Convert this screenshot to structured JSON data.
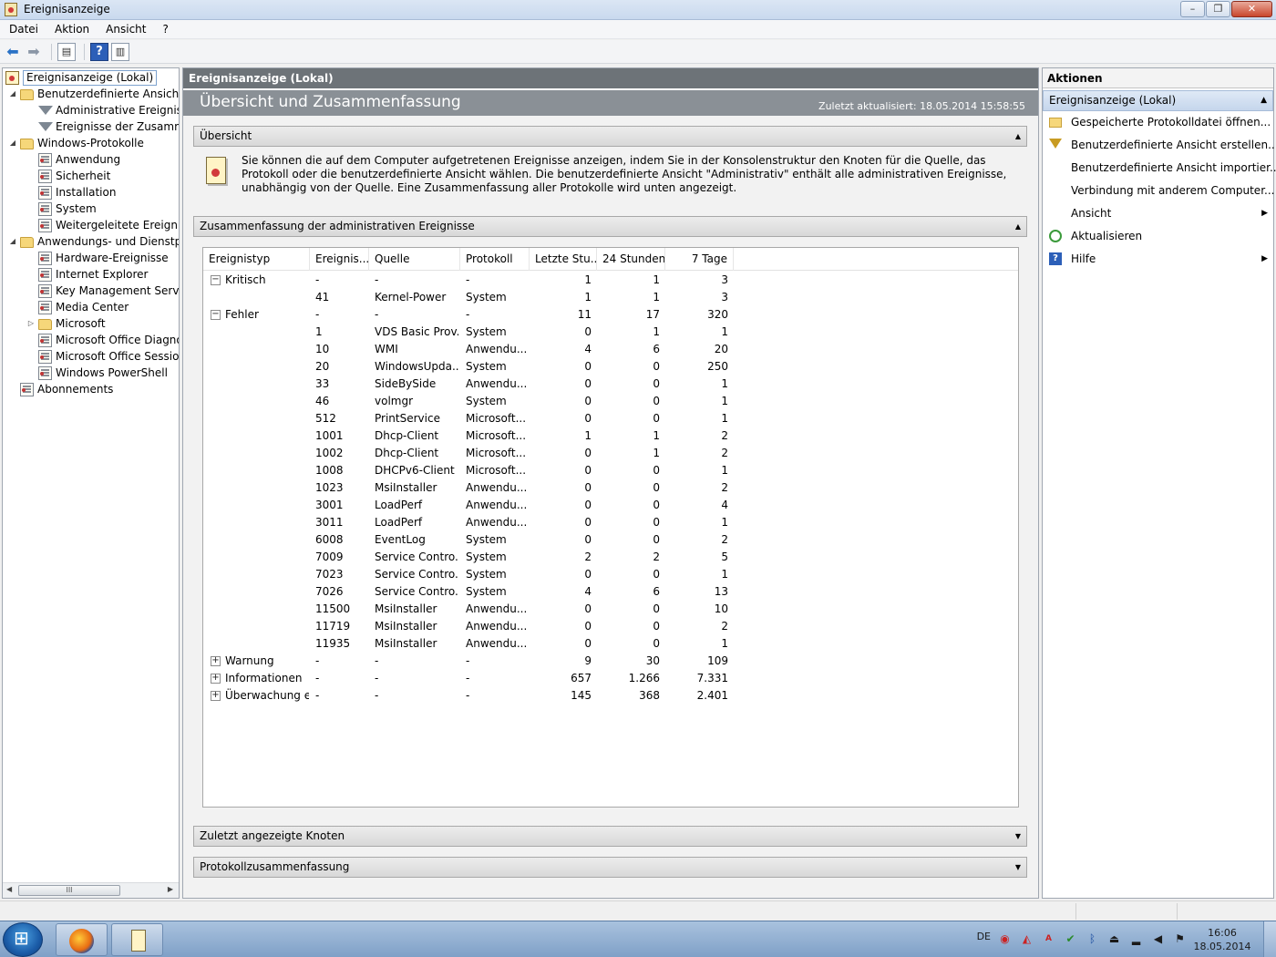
{
  "window": {
    "title": "Ereignisanzeige",
    "min": "–",
    "max": "❐",
    "close": "✕"
  },
  "menu": [
    "Datei",
    "Aktion",
    "Ansicht",
    "?"
  ],
  "tree": {
    "root": "Ereignisanzeige (Lokal)",
    "items": [
      {
        "label": "Benutzerdefinierte Ansichten",
        "icon": "folder-icon",
        "level": 1,
        "expander": "◢"
      },
      {
        "label": "Administrative Ereignisse",
        "icon": "filter-icon",
        "level": 2,
        "expander": ""
      },
      {
        "label": "Ereignisse der Zusammenfassung",
        "icon": "filter-icon",
        "level": 2,
        "expander": ""
      },
      {
        "label": "Windows-Protokolle",
        "icon": "folder-icon",
        "level": 1,
        "expander": "◢"
      },
      {
        "label": "Anwendung",
        "icon": "log-icon",
        "level": 2,
        "expander": ""
      },
      {
        "label": "Sicherheit",
        "icon": "log-icon",
        "level": 2,
        "expander": ""
      },
      {
        "label": "Installation",
        "icon": "log-icon",
        "level": 2,
        "expander": ""
      },
      {
        "label": "System",
        "icon": "log-icon",
        "level": 2,
        "expander": ""
      },
      {
        "label": "Weitergeleitete Ereignisse",
        "icon": "log-icon",
        "level": 2,
        "expander": ""
      },
      {
        "label": "Anwendungs- und Dienstprotokolle",
        "icon": "folder-icon",
        "level": 1,
        "expander": "◢"
      },
      {
        "label": "Hardware-Ereignisse",
        "icon": "log-icon",
        "level": 2,
        "expander": ""
      },
      {
        "label": "Internet Explorer",
        "icon": "log-icon",
        "level": 2,
        "expander": ""
      },
      {
        "label": "Key Management Service",
        "icon": "log-icon",
        "level": 2,
        "expander": ""
      },
      {
        "label": "Media Center",
        "icon": "log-icon",
        "level": 2,
        "expander": ""
      },
      {
        "label": "Microsoft",
        "icon": "folder-icon",
        "level": 2,
        "expander": "▷"
      },
      {
        "label": "Microsoft Office Diagnostics",
        "icon": "log-icon",
        "level": 2,
        "expander": ""
      },
      {
        "label": "Microsoft Office Sessions",
        "icon": "log-icon",
        "level": 2,
        "expander": ""
      },
      {
        "label": "Windows PowerShell",
        "icon": "log-icon",
        "level": 2,
        "expander": ""
      },
      {
        "label": "Abonnements",
        "icon": "subscription-icon",
        "level": 1,
        "expander": ""
      }
    ],
    "scroll_thumb": "III"
  },
  "center": {
    "header": "Ereignisanzeige (Lokal)",
    "title": "Übersicht und Zusammenfassung",
    "updated": "Zuletzt aktualisiert: 18.05.2014 15:58:55",
    "sections": {
      "overview": "Übersicht",
      "summary": "Zusammenfassung der administrativen Ereignisse",
      "recent": "Zuletzt angezeigte Knoten",
      "logsummary": "Protokollzusammenfassung"
    },
    "overview_text": "Sie können die auf dem Computer aufgetretenen Ereignisse anzeigen, indem Sie in der Konsolenstruktur den Knoten für die Quelle, das Protokoll oder die benutzerdefinierte Ansicht wählen. Die benutzerdefinierte Ansicht \"Administrativ\" enthält alle administrativen Ereignisse, unabhängig von der Quelle. Eine Zusammenfassung aller Protokolle wird unten angezeigt."
  },
  "grid": {
    "columns": [
      "Ereignistyp",
      "Ereignis...",
      "Quelle",
      "Protokoll",
      "Letzte Stu...",
      "24 Stunden",
      "7 Tage"
    ],
    "rows": [
      {
        "type": "Kritisch",
        "expander": "−",
        "id": "-",
        "source": "-",
        "log": "-",
        "h": "1",
        "d": "1",
        "w": "3"
      },
      {
        "type": "",
        "expander": "",
        "id": "41",
        "source": "Kernel-Power",
        "log": "System",
        "h": "1",
        "d": "1",
        "w": "3"
      },
      {
        "type": "Fehler",
        "expander": "−",
        "id": "-",
        "source": "-",
        "log": "-",
        "h": "11",
        "d": "17",
        "w": "320"
      },
      {
        "type": "",
        "expander": "",
        "id": "1",
        "source": "VDS Basic Prov...",
        "log": "System",
        "h": "0",
        "d": "1",
        "w": "1"
      },
      {
        "type": "",
        "expander": "",
        "id": "10",
        "source": "WMI",
        "log": "Anwendu...",
        "h": "4",
        "d": "6",
        "w": "20"
      },
      {
        "type": "",
        "expander": "",
        "id": "20",
        "source": "WindowsUpda...",
        "log": "System",
        "h": "0",
        "d": "0",
        "w": "250"
      },
      {
        "type": "",
        "expander": "",
        "id": "33",
        "source": "SideBySide",
        "log": "Anwendu...",
        "h": "0",
        "d": "0",
        "w": "1"
      },
      {
        "type": "",
        "expander": "",
        "id": "46",
        "source": "volmgr",
        "log": "System",
        "h": "0",
        "d": "0",
        "w": "1"
      },
      {
        "type": "",
        "expander": "",
        "id": "512",
        "source": "PrintService",
        "log": "Microsoft...",
        "h": "0",
        "d": "0",
        "w": "1"
      },
      {
        "type": "",
        "expander": "",
        "id": "1001",
        "source": "Dhcp-Client",
        "log": "Microsoft...",
        "h": "1",
        "d": "1",
        "w": "2"
      },
      {
        "type": "",
        "expander": "",
        "id": "1002",
        "source": "Dhcp-Client",
        "log": "Microsoft...",
        "h": "0",
        "d": "1",
        "w": "2"
      },
      {
        "type": "",
        "expander": "",
        "id": "1008",
        "source": "DHCPv6-Client",
        "log": "Microsoft...",
        "h": "0",
        "d": "0",
        "w": "1"
      },
      {
        "type": "",
        "expander": "",
        "id": "1023",
        "source": "MsiInstaller",
        "log": "Anwendu...",
        "h": "0",
        "d": "0",
        "w": "2"
      },
      {
        "type": "",
        "expander": "",
        "id": "3001",
        "source": "LoadPerf",
        "log": "Anwendu...",
        "h": "0",
        "d": "0",
        "w": "4"
      },
      {
        "type": "",
        "expander": "",
        "id": "3011",
        "source": "LoadPerf",
        "log": "Anwendu...",
        "h": "0",
        "d": "0",
        "w": "1"
      },
      {
        "type": "",
        "expander": "",
        "id": "6008",
        "source": "EventLog",
        "log": "System",
        "h": "0",
        "d": "0",
        "w": "2"
      },
      {
        "type": "",
        "expander": "",
        "id": "7009",
        "source": "Service Contro...",
        "log": "System",
        "h": "2",
        "d": "2",
        "w": "5"
      },
      {
        "type": "",
        "expander": "",
        "id": "7023",
        "source": "Service Contro...",
        "log": "System",
        "h": "0",
        "d": "0",
        "w": "1"
      },
      {
        "type": "",
        "expander": "",
        "id": "7026",
        "source": "Service Contro...",
        "log": "System",
        "h": "4",
        "d": "6",
        "w": "13"
      },
      {
        "type": "",
        "expander": "",
        "id": "11500",
        "source": "MsiInstaller",
        "log": "Anwendu...",
        "h": "0",
        "d": "0",
        "w": "10"
      },
      {
        "type": "",
        "expander": "",
        "id": "11719",
        "source": "MsiInstaller",
        "log": "Anwendu...",
        "h": "0",
        "d": "0",
        "w": "2"
      },
      {
        "type": "",
        "expander": "",
        "id": "11935",
        "source": "MsiInstaller",
        "log": "Anwendu...",
        "h": "0",
        "d": "0",
        "w": "1"
      },
      {
        "type": "Warnung",
        "expander": "+",
        "id": "-",
        "source": "-",
        "log": "-",
        "h": "9",
        "d": "30",
        "w": "109"
      },
      {
        "type": "Informationen",
        "expander": "+",
        "id": "-",
        "source": "-",
        "log": "-",
        "h": "657",
        "d": "1.266",
        "w": "7.331"
      },
      {
        "type": "Überwachung e...",
        "expander": "+",
        "id": "-",
        "source": "-",
        "log": "-",
        "h": "145",
        "d": "368",
        "w": "2.401"
      }
    ]
  },
  "actions": {
    "title": "Aktionen",
    "group": "Ereignisanzeige (Lokal)",
    "items": [
      {
        "label": "Gespeicherte Protokolldatei öffnen...",
        "icon": "open-folder-icon",
        "submenu": false
      },
      {
        "label": "Benutzerdefinierte Ansicht erstellen...",
        "icon": "funnel-icon",
        "submenu": false
      },
      {
        "label": "Benutzerdefinierte Ansicht importier...",
        "icon": "",
        "submenu": false
      },
      {
        "label": "Verbindung mit anderem Computer...",
        "icon": "",
        "submenu": false
      },
      {
        "label": "Ansicht",
        "icon": "",
        "submenu": true
      },
      {
        "label": "Aktualisieren",
        "icon": "refresh-icon",
        "submenu": false
      },
      {
        "label": "Hilfe",
        "icon": "help-icon",
        "submenu": true
      }
    ]
  },
  "taskbar": {
    "lang": "DE",
    "time": "16:06",
    "date": "18.05.2014"
  }
}
